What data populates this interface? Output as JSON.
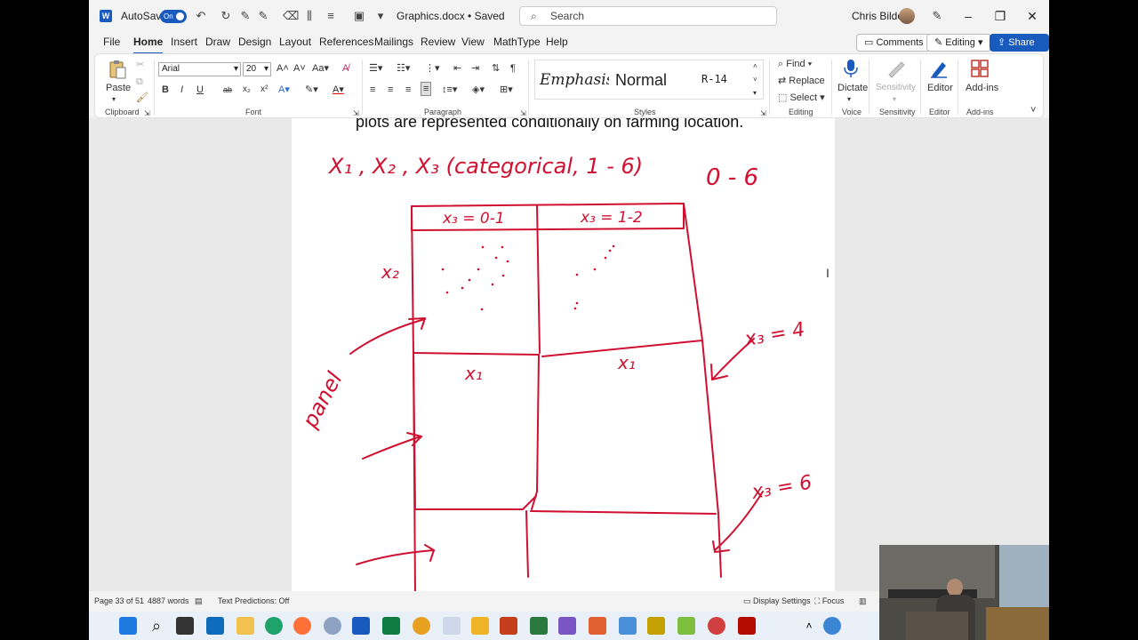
{
  "titlebar": {
    "autosave_label": "AutoSave",
    "autosave_state": "On",
    "document_title": "Graphics.docx • Saved",
    "search_placeholder": "Search",
    "user_name": "Chris Bilder"
  },
  "menu": {
    "tabs": [
      "File",
      "Home",
      "Insert",
      "Draw",
      "Design",
      "Layout",
      "References",
      "Mailings",
      "Review",
      "View",
      "MathType",
      "Help"
    ],
    "active_tab": "Home",
    "comments_label": "Comments",
    "editing_label": "Editing",
    "share_label": "Share"
  },
  "ribbon": {
    "paste_label": "Paste",
    "clipboard_label": "Clipboard",
    "font_name": "Arial",
    "font_size": "20",
    "font_label": "Font",
    "paragraph_label": "Paragraph",
    "styles": [
      "Emphasis",
      "Normal",
      "R-14"
    ],
    "styles_label": "Styles",
    "find_label": "Find",
    "replace_label": "Replace",
    "select_label": "Select",
    "editing_group_label": "Editing",
    "dictate_label": "Dictate",
    "voice_label": "Voice",
    "sensitivity_label": "Sensitivity",
    "sensitivity_group_label": "Sensitivity",
    "editor_label": "Editor",
    "editor_group_label": "Editor",
    "addins_label": "Add-ins",
    "addins_group_label": "Add-ins",
    "font_buttons": [
      "B",
      "I",
      "U",
      "ab",
      "x₂",
      "x²"
    ]
  },
  "document": {
    "caption": "plots are represented conditionally on farming location.",
    "ink_labels": {
      "vars": "X₁ , X₂ , X₃ (categorical, 1 - 6)",
      "range": "0 - 6",
      "panel1_header": "x₃ = 0-1",
      "panel2_header": "x₃ = 1-2",
      "y_axis": "x₂",
      "x_axis_1": "x₁",
      "x_axis_2": "x₁",
      "x3_4": "x₃ = 4",
      "x3_6": "x₃ = 6",
      "panel_word": "panel"
    }
  },
  "status": {
    "page": "Page 33 of 51",
    "words": "4887 words",
    "predictions": "Text Predictions: Off",
    "display_settings": "Display Settings",
    "focus": "Focus"
  },
  "colors": {
    "accent": "#185abd",
    "ink": "#d01030"
  }
}
